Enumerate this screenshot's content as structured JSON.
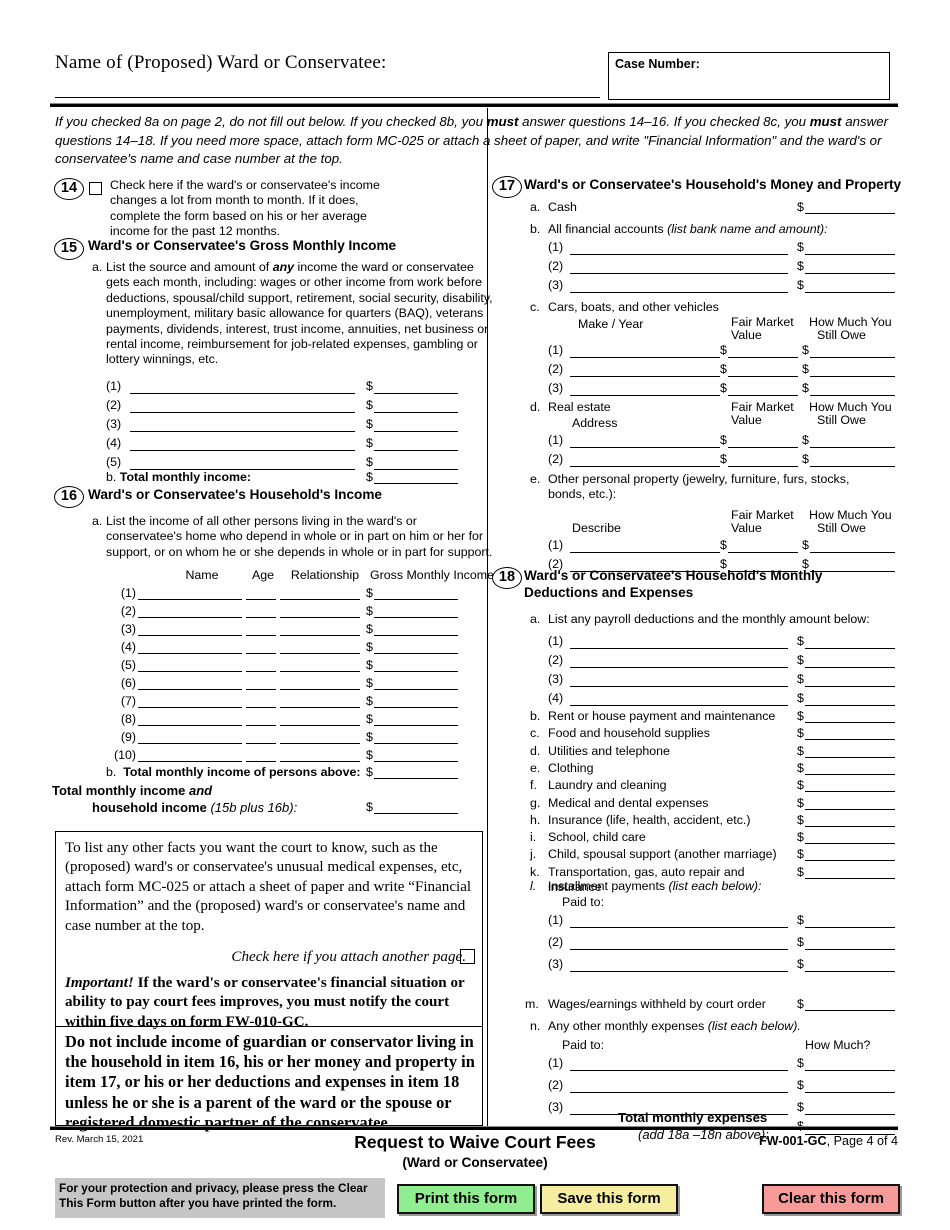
{
  "header": {
    "name_label": "Name of (Proposed) Ward or Conservatee:",
    "case_number_label": "Case Number:"
  },
  "intro": {
    "part1": "If you checked 8a on page 2, do not fill out below. If you checked 8b, you ",
    "must1": "must",
    "part2": " answer questions 14–16. If you checked 8c, you ",
    "must2": "must",
    "part3": " answer questions 14–18. If you need more space, attach form MC-025 or attach a sheet of paper, and write \"Financial Information\" and the ward's or conservatee's name and case number at the top."
  },
  "item14": {
    "number": "14",
    "text": "Check here if the ward's or conservatee's income changes a lot from month to month. If it does, complete the form based on his or her average income for the past 12 months."
  },
  "item15": {
    "number": "15",
    "title": "Ward's or Conservatee's Gross Monthly Income",
    "a_label": "a.",
    "a_text_1": "List the source and amount of ",
    "a_any": "any",
    "a_text_2": " income the ward or conservatee gets each month, including: wages or other income from work before deductions, spousal/child support, retirement, social security, disability, unemployment, military basic allowance for quarters (BAQ), veterans payments, dividends, interest, trust income, annuities, net business or rental income, reimbursement for job-related expenses, gambling or lottery winnings, etc.",
    "rows": [
      "(1)",
      "(2)",
      "(3)",
      "(4)",
      "(5)"
    ],
    "b_label": "b.",
    "b_text": "Total monthly income:",
    "dollar": "$"
  },
  "item16": {
    "number": "16",
    "title": "Ward's or Conservatee's Household's Income",
    "a_label": "a.",
    "a_text": "List the income of all other persons living in the ward's or conservatee's home who depend in whole or in part on him or her for support, or on whom he or she depends in whole or in part for support.",
    "columns": [
      "Name",
      "Age",
      "Relationship",
      "Gross Monthly Income"
    ],
    "rows": [
      "(1)",
      "(2)",
      "(3)",
      "(4)",
      "(5)",
      "(6)",
      "(7)",
      "(8)",
      "(9)",
      "(10)"
    ],
    "b_label": "b.",
    "b_text": "Total monthly income of persons above:",
    "total_line1": "Total monthly income ",
    "total_and": "and",
    "total_line2": "household income ",
    "total_note": "(15b plus 16b):",
    "dollar": "$"
  },
  "item17": {
    "number": "17",
    "title": "Ward's or Conservatee's Household's Money and Property",
    "a_label": "a.",
    "a_text": "Cash",
    "b_label": "b.",
    "b_text": "All financial accounts ",
    "b_note": "(list bank name and amount):",
    "b_rows": [
      "(1)",
      "(2)",
      "(3)"
    ],
    "c_label": "c.",
    "c_text": "Cars, boats, and other vehicles",
    "c_col1": "Make / Year",
    "c_col2_l1": "Fair Market",
    "c_col2_l2": "Value",
    "c_col3_l1": "How Much You",
    "c_col3_l2": "Still Owe",
    "c_rows": [
      "(1)",
      "(2)",
      "(3)"
    ],
    "d_label": "d.",
    "d_text": "Real estate",
    "d_col1": "Address",
    "d_rows": [
      "(1)",
      "(2)"
    ],
    "e_label": "e.",
    "e_text": "Other personal property (jewelry, furniture, furs, stocks, bonds, etc.):",
    "e_col1": "Describe",
    "e_rows": [
      "(1)",
      "(2)"
    ],
    "dollar": "$"
  },
  "item18": {
    "number": "18",
    "title_l1": "Ward's or Conservatee's Household's Monthly",
    "title_l2": "Deductions and Expenses",
    "a_label": "a.",
    "a_text": "List any payroll deductions and the monthly amount below:",
    "a_rows": [
      "(1)",
      "(2)",
      "(3)",
      "(4)"
    ],
    "simple_items": [
      {
        "label": "b.",
        "text": "Rent or house payment and maintenance"
      },
      {
        "label": "c.",
        "text": "Food and household supplies"
      },
      {
        "label": "d.",
        "text": "Utilities and telephone"
      },
      {
        "label": "e.",
        "text": "Clothing"
      },
      {
        "label": "f.",
        "text": "Laundry and cleaning"
      },
      {
        "label": "g.",
        "text": "Medical and dental expenses"
      },
      {
        "label": "h.",
        "text": "Insurance (life, health, accident, etc.)"
      },
      {
        "label": "i.",
        "text": "School, child care"
      },
      {
        "label": "j.",
        "text": "Child, spousal support (another marriage)"
      },
      {
        "label": "k.",
        "text": "Transportation, gas, auto repair and insurance"
      }
    ],
    "l_label": "l.",
    "l_text": "Installment payments ",
    "l_note": "(list each below):",
    "l_paidto": "Paid to:",
    "l_rows": [
      "(1)",
      "(2)",
      "(3)"
    ],
    "m_label": "m.",
    "m_text": "Wages/earnings withheld by court order",
    "n_label": "n.",
    "n_text": "Any other monthly expenses ",
    "n_note": "(list each below).",
    "n_paidto": "Paid to:",
    "n_howmuch": "How Much?",
    "n_rows": [
      "(1)",
      "(2)",
      "(3)"
    ],
    "total_l1": "Total monthly expenses",
    "total_l2": "(add 18a –18n above):",
    "dollar": "$"
  },
  "narrative": {
    "body": "To list any other facts you want the court to know, such as the (proposed) ward's or conservatee's unusual medical expenses, etc, attach form MC-025 or attach a sheet of paper and write “Financial Information” and the (proposed) ward's or conservatee's name and case number at the top.",
    "check_attach": "Check here if you attach another page.",
    "important_lead": "Important!",
    "important_body": " If the ward's or conservatee's financial situation or ability to pay court fees improves, you must notify the court within five days on form FW-010-GC.",
    "do_not": "Do not include income of guardian or conservator living in the household in item 16, his or her money and property in item 17, or his or her deductions and expenses in item 18 unless he or she is a parent of the ward or the spouse or registered domestic partner of the conservatee."
  },
  "footer": {
    "revision": "Rev. March 15, 2021",
    "title": "Request to Waive Court Fees",
    "subtitle": "(Ward or Conservatee)",
    "form_code": "FW-001-GC",
    "page_label": ", Page 4 of 4",
    "privacy_notice": "For your protection and privacy, please press the Clear This Form button after you have printed the form.",
    "print_button": "Print this form",
    "save_button": "Save this form",
    "clear_button": "Clear this form"
  },
  "colors": {
    "print_green": "#90ee90",
    "save_yellow": "#f5eda0",
    "clear_red": "#f79b99",
    "privacy_gray": "#c6c6c6"
  }
}
